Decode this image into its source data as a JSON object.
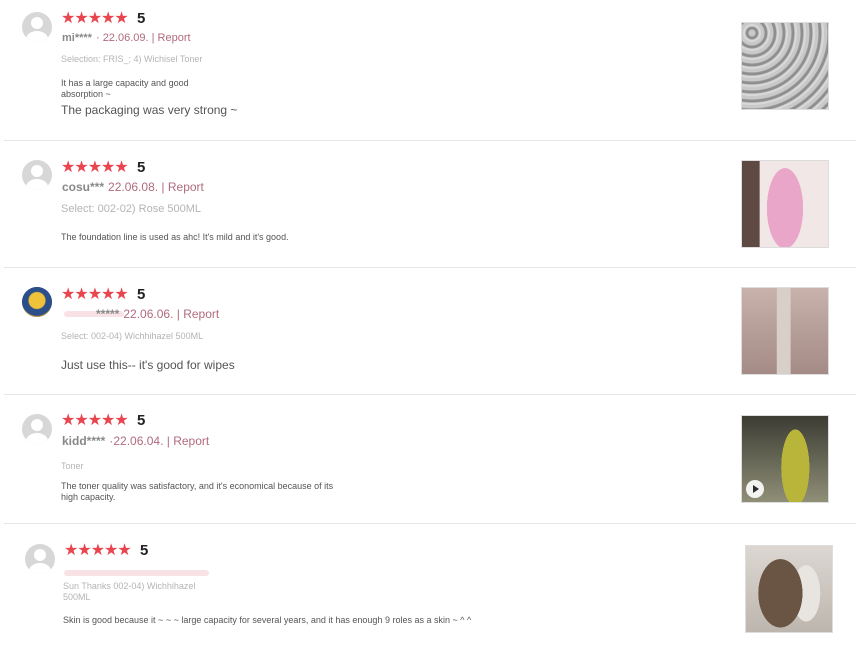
{
  "reviews": [
    {
      "avatar_type": "default",
      "stars": "★★★★★",
      "score": "5",
      "user": "mi****",
      "date": "· 22.06.09.",
      "report": "| Report",
      "selection": "Selection: FRIS_; 4) Wichisel Toner",
      "text_small": "It has a large capacity and good absorption ~",
      "text_big": "The packaging was very strong ~",
      "photo_style": "bubble-wrap"
    },
    {
      "avatar_type": "default",
      "stars": "★★★★★",
      "score": "5",
      "user": "cosu***",
      "date": "22.06.08.",
      "report": "| Report",
      "selection": "Select: 002-02) Rose 500ML",
      "text_small": "The foundation line is used as ahc! It's mild and it's good.",
      "text_big": "",
      "photo_style": "pink-bottle"
    },
    {
      "avatar_type": "custom",
      "stars": "★★★★★",
      "score": "5",
      "user": "*****",
      "date": "22.06.06.",
      "report": "| Report",
      "selection": "Select: 002-04) Wichhihazel 500ML",
      "text_small": "",
      "text_big": "Just use this-- it's good for wipes",
      "photo_style": "clear-bottle"
    },
    {
      "avatar_type": "default",
      "stars": "★★★★★",
      "score": "5",
      "user": "kidd****",
      "date": "·22.06.04.",
      "report": "| Report",
      "selection": "Toner",
      "text_small": "The toner quality was satisfactory, and it's economical because of its high capacity.",
      "text_big": "",
      "photo_style": "green-bottle-video"
    },
    {
      "avatar_type": "default",
      "stars": "★★★★★",
      "score": "5",
      "user": "",
      "date": "",
      "report": "",
      "selection": "Sun Thanks 002-04) Wichhihazel 500ML",
      "text_small": "Skin is good because it ~ ~ ~ large capacity for several years, and it has enough 9 roles as a skin ~ ^ ^",
      "text_big": "",
      "photo_style": "two-bottles"
    }
  ],
  "colors": {
    "star": "#e9454f",
    "link": "#b06b7e",
    "divider": "#e6e6e6"
  }
}
